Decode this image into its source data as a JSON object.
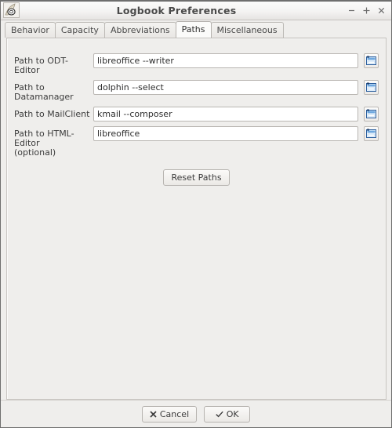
{
  "window": {
    "title": "Logbook Preferences",
    "app_icon": "quill-pen-icon",
    "controls": [
      {
        "name": "minimize",
        "glyph": "−"
      },
      {
        "name": "maximize",
        "glyph": "+"
      },
      {
        "name": "close",
        "glyph": "×"
      }
    ]
  },
  "tabs": [
    {
      "label": "Behavior",
      "selected": false
    },
    {
      "label": "Capacity",
      "selected": false
    },
    {
      "label": "Abbreviations",
      "selected": false
    },
    {
      "label": "Paths",
      "selected": true
    },
    {
      "label": "Miscellaneous",
      "selected": false
    }
  ],
  "paths_tab": {
    "rows": [
      {
        "label": "Path to ODT-Editor",
        "value": "libreoffice --writer",
        "placeholder": "",
        "browse_icon": "open-folder-icon"
      },
      {
        "label": "Path to Datamanager",
        "value": "dolphin --select",
        "placeholder": "",
        "browse_icon": "open-folder-icon"
      },
      {
        "label": "Path to MailClient",
        "value": "kmail --composer",
        "placeholder": "",
        "browse_icon": "open-folder-icon"
      },
      {
        "label": "Path to HTML-Editor\n(optional)",
        "value": "libreoffice",
        "placeholder": "",
        "browse_icon": "open-folder-icon"
      }
    ],
    "reset_label": "Reset Paths"
  },
  "footer": {
    "cancel_label": "Cancel",
    "cancel_icon": "cross-icon",
    "ok_label": "OK",
    "ok_icon": "check-icon"
  },
  "colors": {
    "window_bg": "#efeeec",
    "field_bg": "#ffffff",
    "border": "#b9b6b2",
    "text": "#3c3c3c",
    "title_text": "#4a4a4a",
    "icon_blue": "#3a78c2"
  }
}
